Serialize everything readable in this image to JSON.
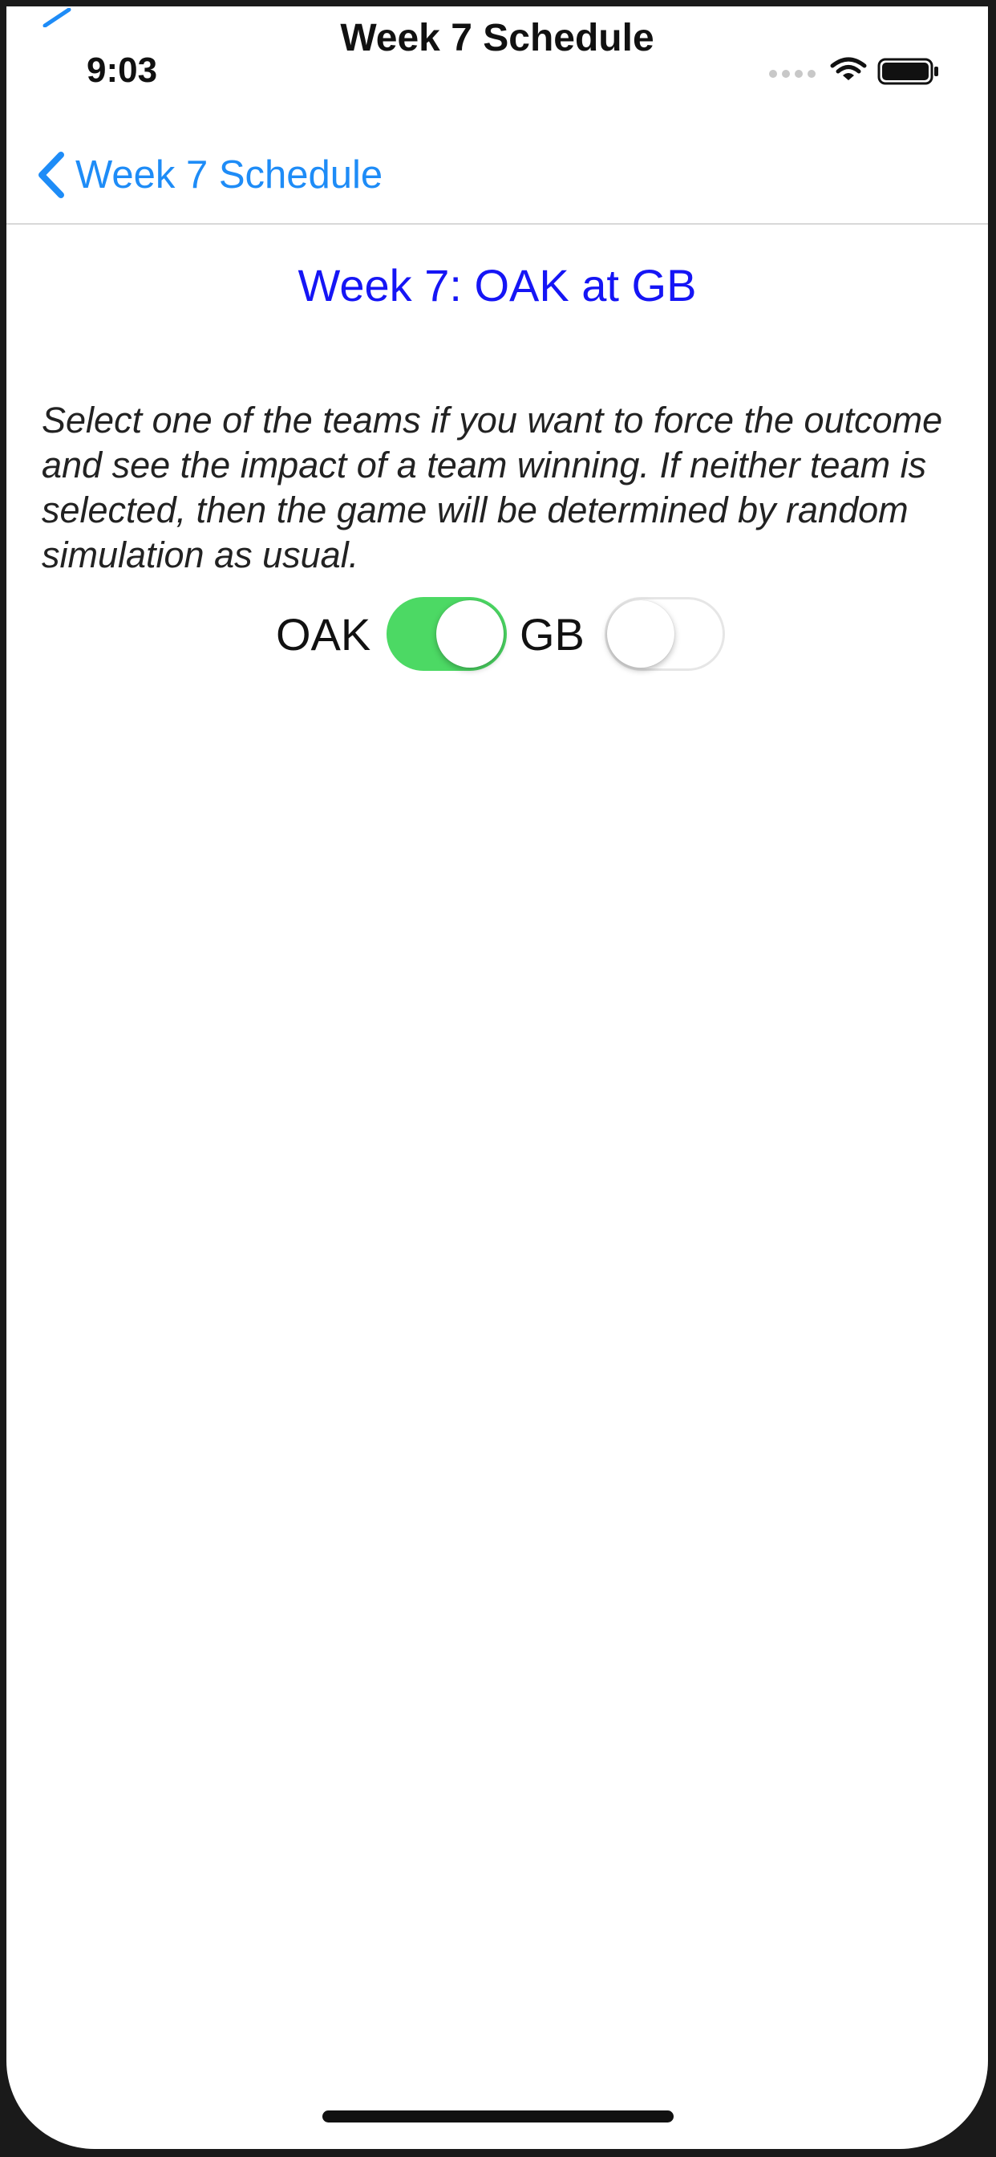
{
  "window": {
    "title": "Week 7 Schedule"
  },
  "status_bar": {
    "time": "9:03",
    "icons": [
      "signal-dots-icon",
      "wifi-icon",
      "battery-icon"
    ]
  },
  "nav_bar": {
    "back_label": "Week 7 Schedule",
    "back_icon": "chevron-left-icon"
  },
  "game": {
    "title": "Week 7: OAK at GB",
    "instructions": "Select one of the teams if you want to force the outcome and see the impact  of a team winning. If neither team is selected, then the game will be determined by random simulation as usual.",
    "teams": [
      {
        "label": "OAK",
        "selected": true
      },
      {
        "label": "GB",
        "selected": false
      }
    ]
  },
  "colors": {
    "back_link": "#1e8cf7",
    "game_title": "#1515f5",
    "toggle_on": "#4cd964",
    "toggle_off_border": "#e6e6e6"
  }
}
